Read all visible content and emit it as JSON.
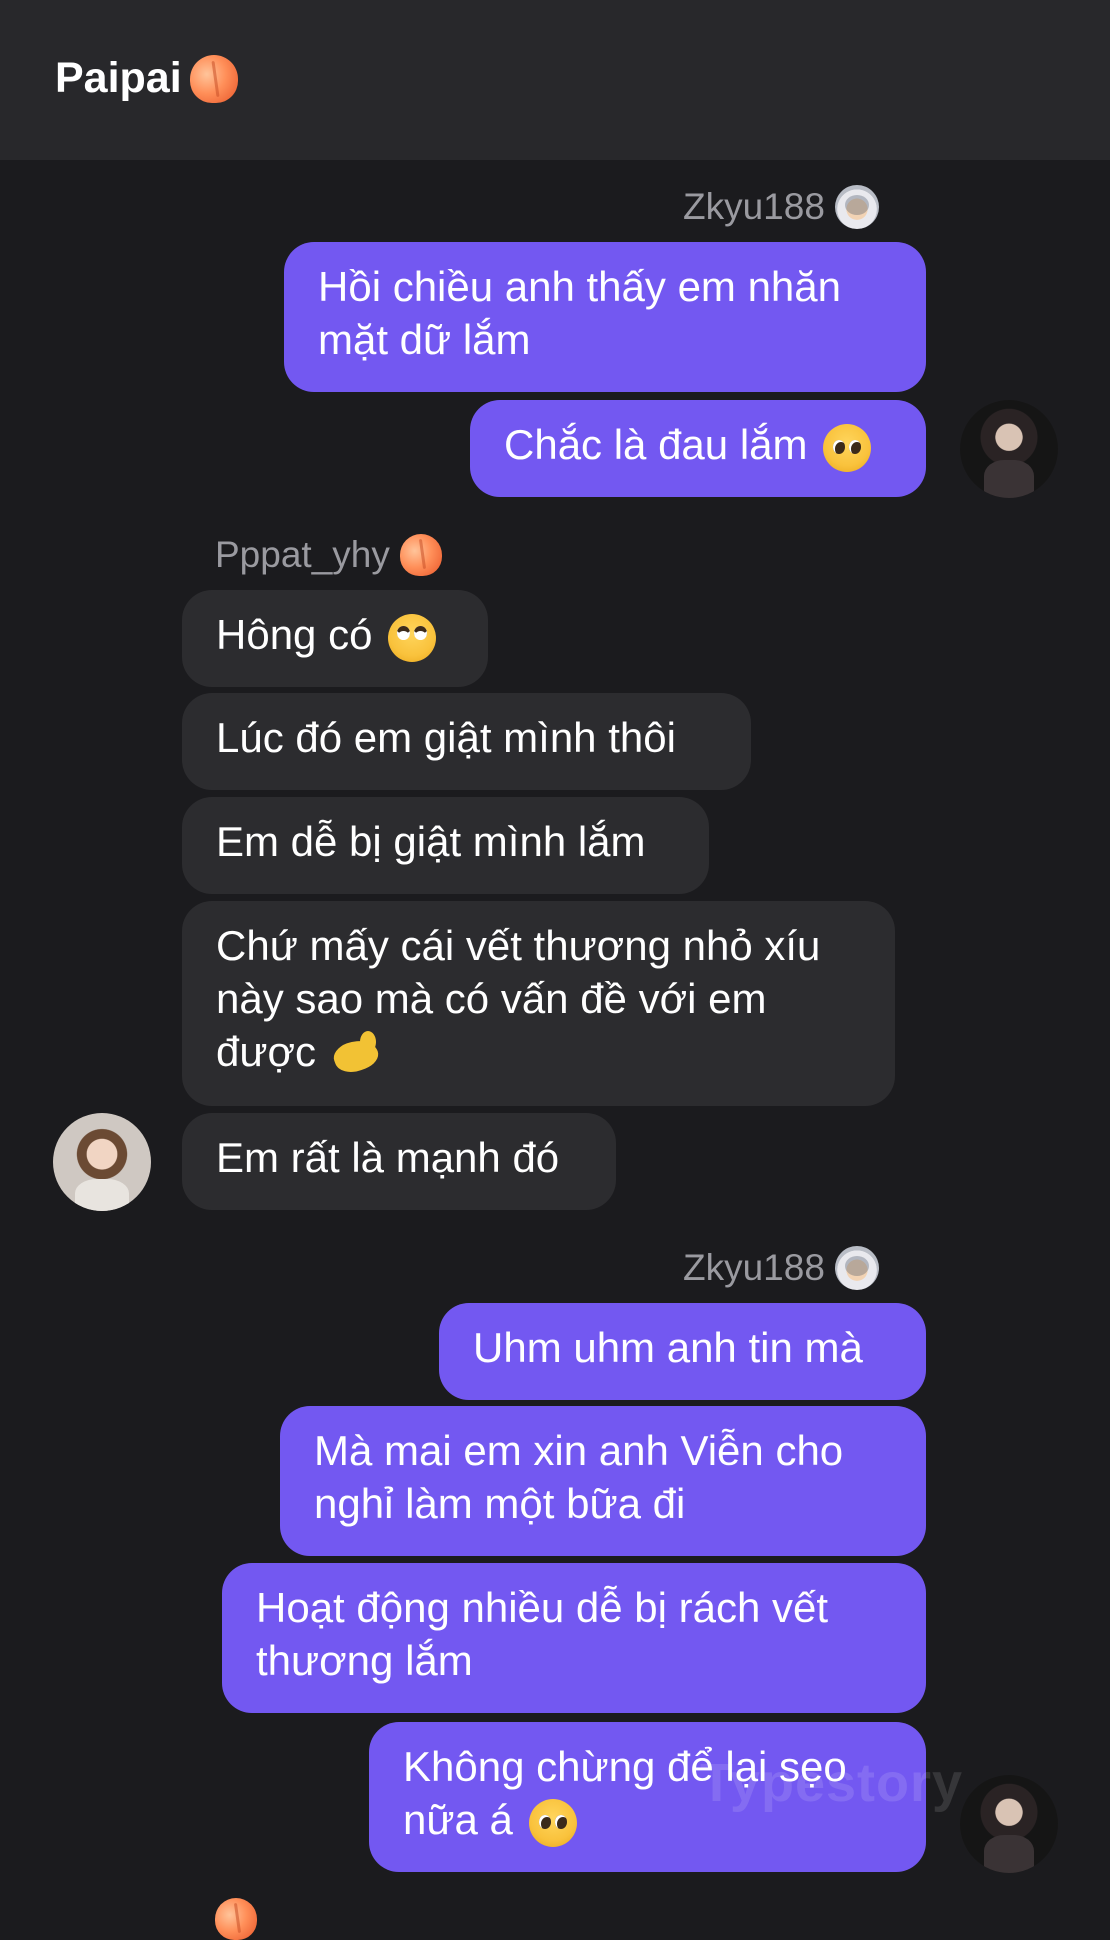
{
  "header": {
    "title": "Paipai",
    "title_emoji": "peach-emoji"
  },
  "messages": [
    {
      "sender": "Zkyu188",
      "sender_emoji": "astronaut-emoji",
      "direction": "out",
      "text": "Hồi chiều anh thấy em nhăn mặt dữ lắm"
    },
    {
      "sender": "Zkyu188",
      "direction": "out",
      "text": "Chắc là đau lắm",
      "emoji": "pleading-face-emoji"
    },
    {
      "sender": "Pppat_yhy",
      "sender_emoji": "peach-emoji",
      "direction": "in",
      "text": "Hông có",
      "emoji": "eye-roll-face-emoji"
    },
    {
      "sender": "Pppat_yhy",
      "direction": "in",
      "text": "Lúc đó em giật mình thôi"
    },
    {
      "sender": "Pppat_yhy",
      "direction": "in",
      "text": "Em dễ bị giật mình lắm"
    },
    {
      "sender": "Pppat_yhy",
      "direction": "in",
      "text": "Chứ mấy cái vết thương nhỏ xíu này sao mà có vấn đề với em được",
      "emoji": "flexed-biceps-emoji"
    },
    {
      "sender": "Pppat_yhy",
      "direction": "in",
      "text": "Em rất là mạnh đó"
    },
    {
      "sender": "Zkyu188",
      "sender_emoji": "astronaut-emoji",
      "direction": "out",
      "text": "Uhm uhm anh tin mà"
    },
    {
      "sender": "Zkyu188",
      "direction": "out",
      "text": "Mà mai em xin anh Viễn cho nghỉ làm một bữa đi"
    },
    {
      "sender": "Zkyu188",
      "direction": "out",
      "text": "Hoạt động nhiều dễ bị rách vết thương lắm"
    },
    {
      "sender": "Zkyu188",
      "direction": "out",
      "text": "Không chừng để lại sẹo nữa á",
      "emoji": "pleading-face-emoji"
    }
  ],
  "labels": {
    "zkyu_1": "Zkyu188",
    "pppat_1": "Pppat_yhy",
    "zkyu_2": "Zkyu188"
  },
  "watermark": "Typestory",
  "colors": {
    "background": "#1b1b1e",
    "header": "#28282b",
    "outgoing_bubble": "#7358f1",
    "incoming_bubble": "#2c2c2f",
    "sender_label": "#9a9aa0"
  }
}
